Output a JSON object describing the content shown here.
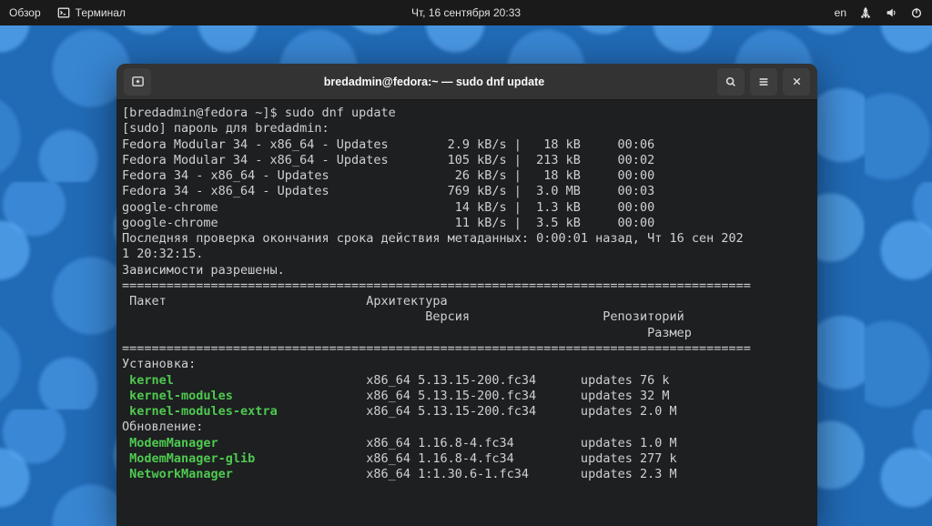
{
  "topbar": {
    "activities": "Обзор",
    "app_label": "Терминал",
    "clock": "Чт, 16 сентября  20:33",
    "lang": "en"
  },
  "window": {
    "title": "bredadmin@fedora:~ — sudo dnf update"
  },
  "terminal": {
    "prompt": "[bredadmin@fedora ~]$ ",
    "command": "sudo dnf update",
    "sudo_line": "[sudo] пароль для bredadmin:",
    "repos": [
      {
        "name": "Fedora Modular 34 - x86_64 - Updates",
        "speed": "2.9 kB/s",
        "size": "18 kB",
        "time": "00:06"
      },
      {
        "name": "Fedora Modular 34 - x86_64 - Updates",
        "speed": "105 kB/s",
        "size": "213 kB",
        "time": "00:02"
      },
      {
        "name": "Fedora 34 - x86_64 - Updates",
        "speed": "26 kB/s",
        "size": "18 kB",
        "time": "00:00"
      },
      {
        "name": "Fedora 34 - x86_64 - Updates",
        "speed": "769 kB/s",
        "size": "3.0 MB",
        "time": "00:03"
      },
      {
        "name": "google-chrome",
        "speed": "14 kB/s",
        "size": "1.3 kB",
        "time": "00:00"
      },
      {
        "name": "google-chrome",
        "speed": "11 kB/s",
        "size": "3.5 kB",
        "time": "00:00"
      }
    ],
    "meta_line1": "Последняя проверка окончания срока действия метаданных: 0:00:01 назад, Чт 16 сен 202",
    "meta_line2": "1 20:32:15.",
    "deps_line": "Зависимости разрешены.",
    "header_pkg": "Пакет",
    "header_arch": "Архитектура",
    "header_ver": "Версия",
    "header_repo": "Репозиторий",
    "header_size": "Размер",
    "install_label": "Установка:",
    "update_label": "Обновление:",
    "install_pkgs": [
      {
        "name": "kernel",
        "arch": "x86_64",
        "ver": "5.13.15-200.fc34",
        "repo": "updates",
        "size": "76 k"
      },
      {
        "name": "kernel-modules",
        "arch": "x86_64",
        "ver": "5.13.15-200.fc34",
        "repo": "updates",
        "size": "32 M"
      },
      {
        "name": "kernel-modules-extra",
        "arch": "x86_64",
        "ver": "5.13.15-200.fc34",
        "repo": "updates",
        "size": "2.0 M"
      }
    ],
    "update_pkgs": [
      {
        "name": "ModemManager",
        "arch": "x86_64",
        "ver": "1.16.8-4.fc34",
        "repo": "updates",
        "size": "1.0 M"
      },
      {
        "name": "ModemManager-glib",
        "arch": "x86_64",
        "ver": "1.16.8-4.fc34",
        "repo": "updates",
        "size": "277 k"
      },
      {
        "name": "NetworkManager",
        "arch": "x86_64",
        "ver": "1:1.30.6-1.fc34",
        "repo": "updates",
        "size": "2.3 M"
      }
    ]
  }
}
